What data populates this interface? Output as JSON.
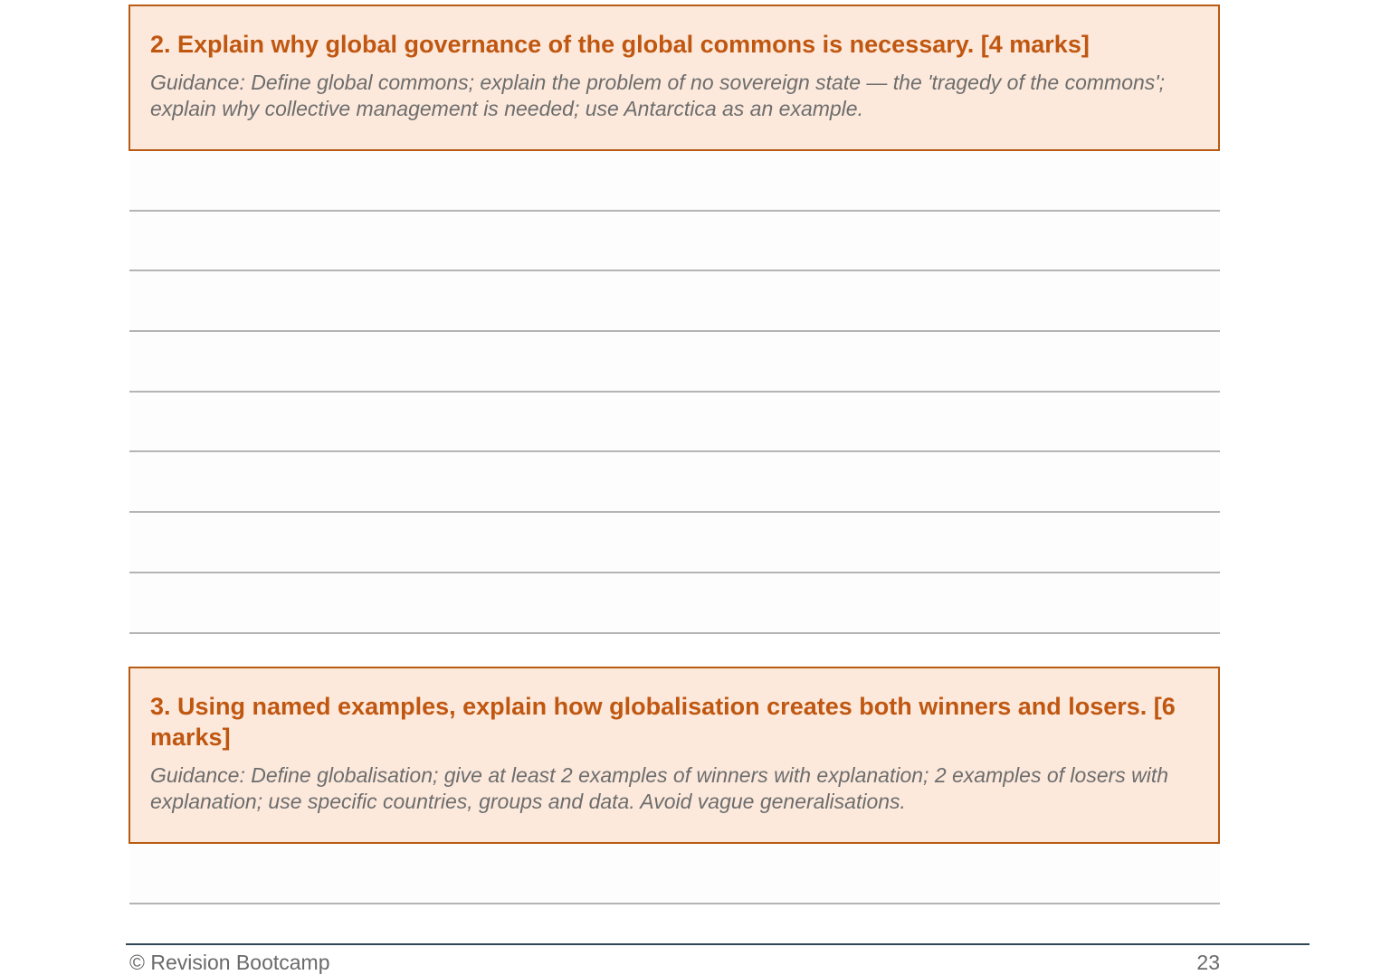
{
  "questions": [
    {
      "title": "2. Explain why global governance of the global commons is necessary. [4 marks]",
      "guidance": "Guidance: Define global commons; explain the problem of no sovereign state — the 'tragedy of the commons'; explain why collective management is needed; use Antarctica as an example.",
      "answer_lines": 8
    },
    {
      "title": "3. Using named examples, explain how globalisation creates both winners and losers. [6 marks]",
      "guidance": "Guidance: Define globalisation; give at least 2 examples of winners with explanation; 2 examples of losers with explanation; use specific countries, groups and data. Avoid vague generalisations.",
      "answer_lines": 1
    }
  ],
  "footer": {
    "copyright": "© Revision Bootcamp",
    "page_number": "23"
  },
  "colors": {
    "accent": "#c05711",
    "box_fill": "#fce9dc",
    "box_border": "#b95b12",
    "guidance_text": "#6d6d6d",
    "rule": "#b4b4b4",
    "footer_rule": "#2f4654"
  }
}
